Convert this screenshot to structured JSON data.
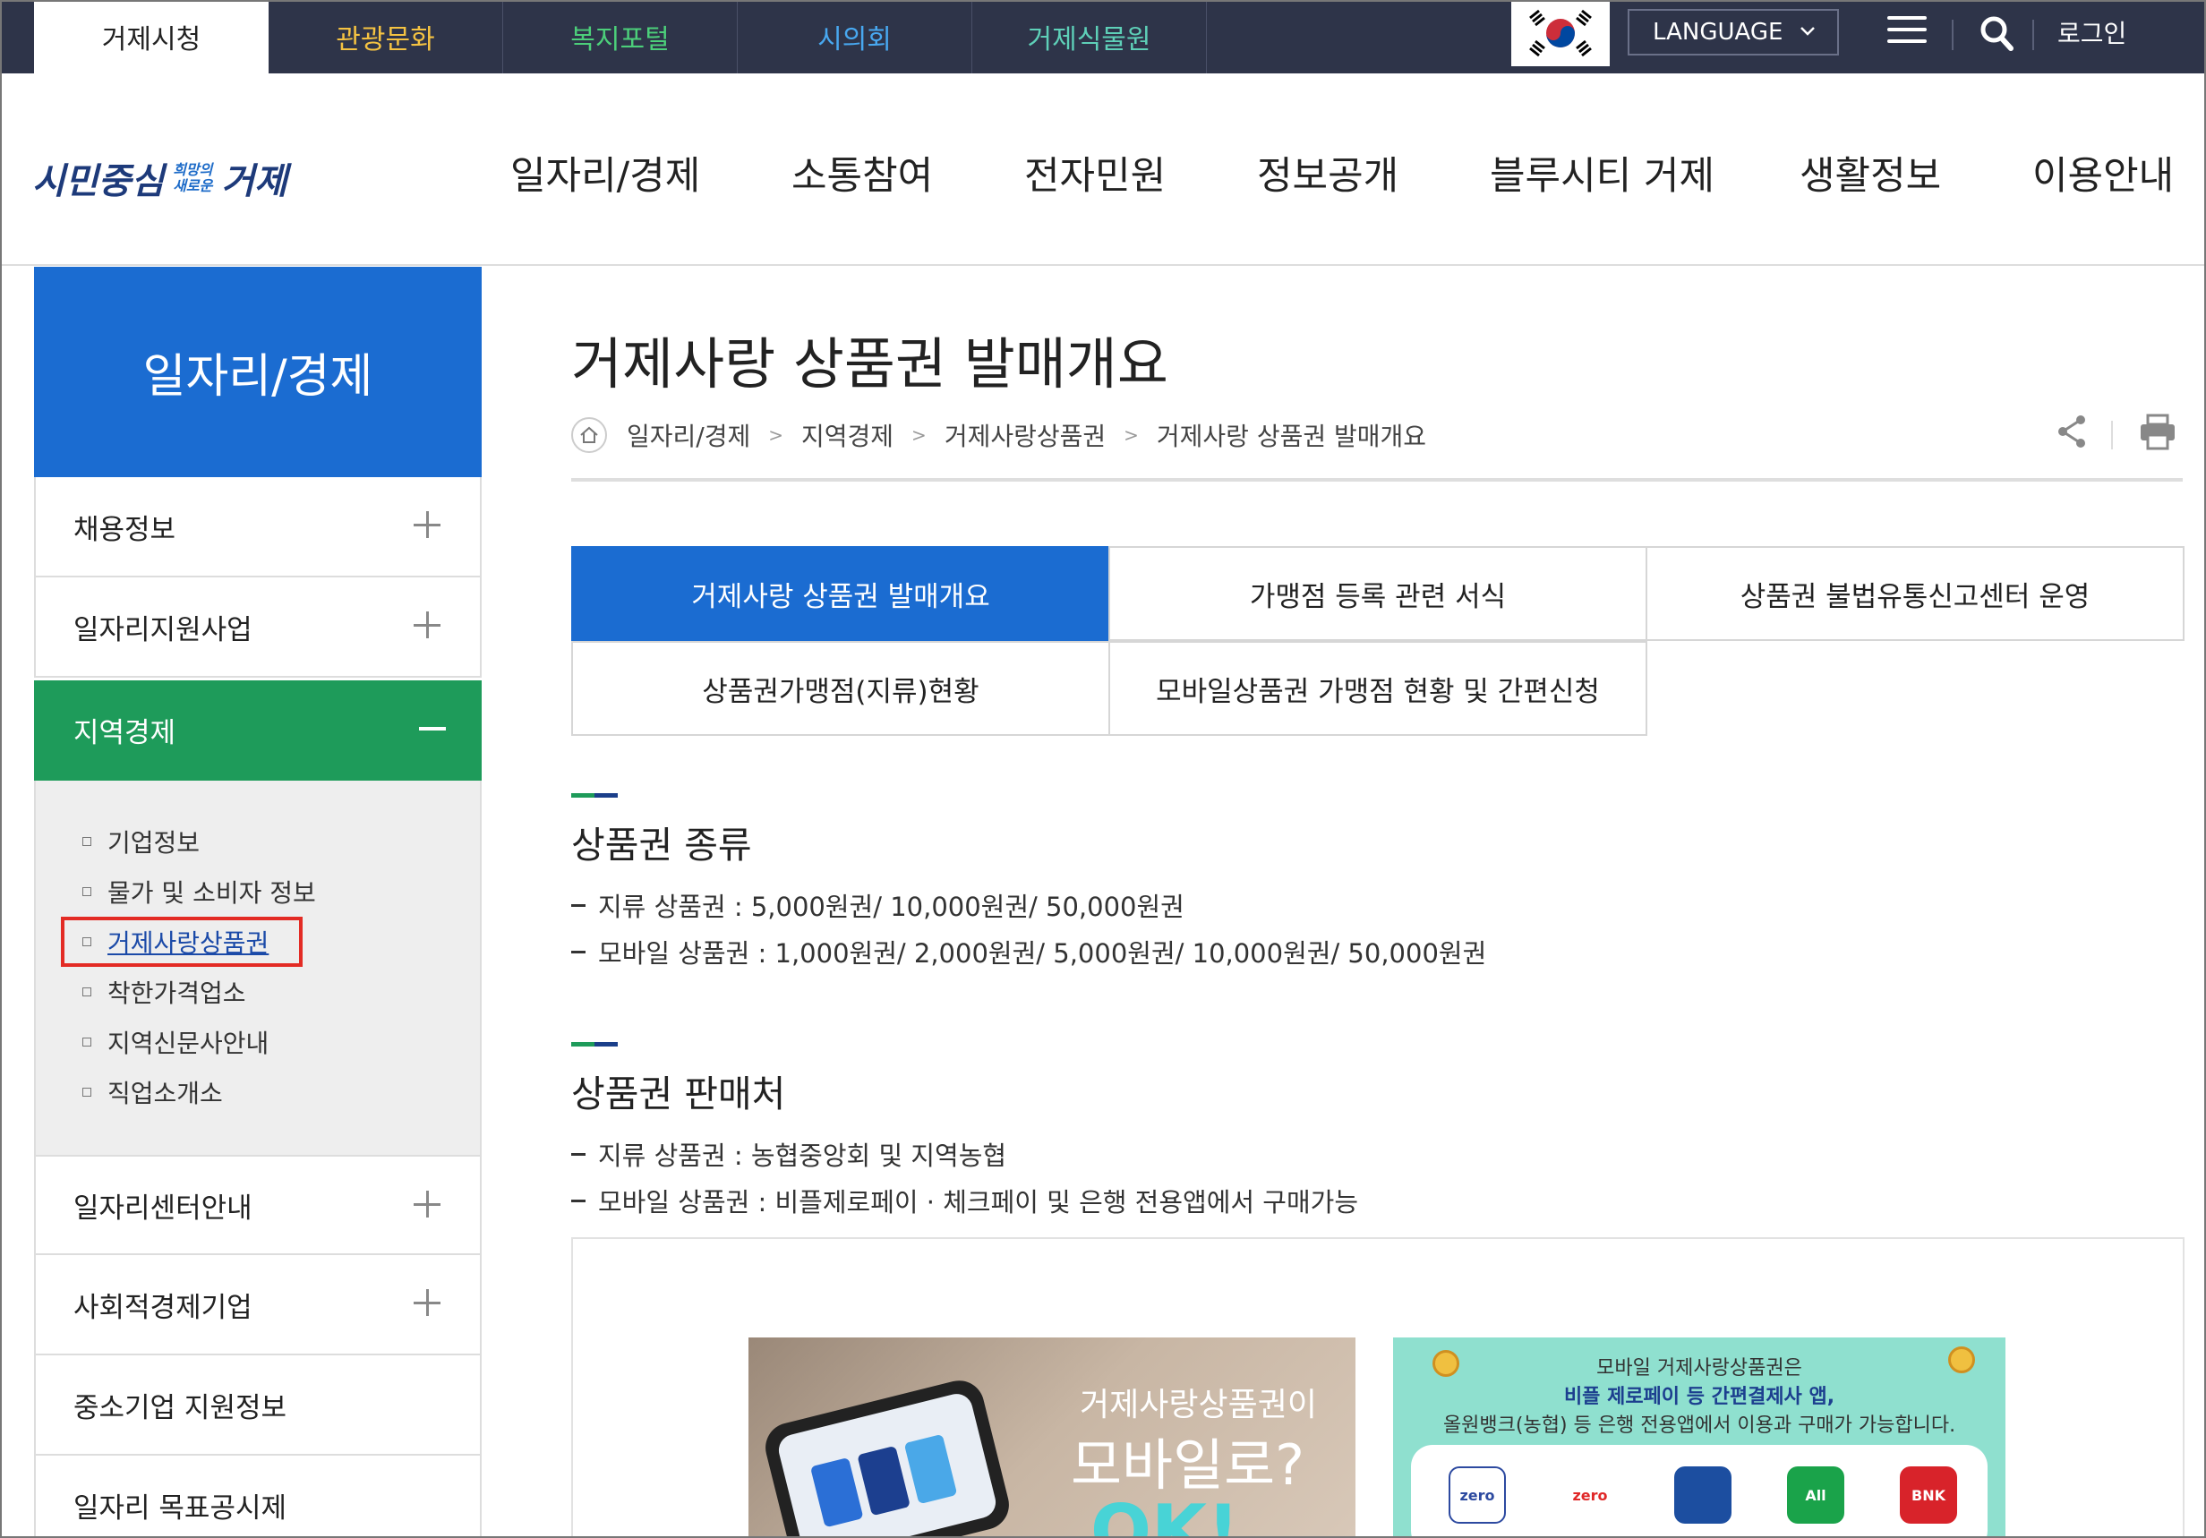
{
  "topbar": {
    "tabs": [
      "거제시청",
      "관광문화",
      "복지포털",
      "시의회",
      "거제식물원"
    ],
    "tab_colors": [
      "#222222",
      "#f5c342",
      "#4ccf7a",
      "#48a8f0",
      "#5ed0b8"
    ],
    "language_label": "LANGUAGE",
    "login_label": "로그인"
  },
  "header": {
    "logo_main_1": "시민중심",
    "logo_small": "희망의\n새로운",
    "logo_main_2": "거제",
    "gnb": [
      "일자리/경제",
      "소통참여",
      "전자민원",
      "정보공개",
      "블루시티 거제",
      "생활정보",
      "이용안내"
    ]
  },
  "sidebar": {
    "title": "일자리/경제",
    "items_before": [
      "채용정보",
      "일자리지원사업"
    ],
    "active_item": "지역경제",
    "sub_items": [
      "기업정보",
      "물가 및 소비자 정보",
      "거제사랑상품권",
      "착한가격업소",
      "지역신문사안내",
      "직업소개소"
    ],
    "items_after": [
      "일자리센터안내",
      "사회적경제기업",
      "중소기업 지원정보",
      "일자리 목표공시제"
    ]
  },
  "content": {
    "page_title": "거제사랑 상품권 발매개요",
    "breadcrumb": [
      "일자리/경제",
      "지역경제",
      "거제사랑상품권",
      "거제사랑 상품권 발매개요"
    ],
    "tabs": [
      "거제사랑 상품권 발매개요",
      "가맹점 등록 관련 서식",
      "상품권 불법유통신고센터 운영",
      "상품권가맹점(지류)현황",
      "모바일상품권 가맹점 현황 및 간편신청"
    ],
    "section1": {
      "title": "상품권 종류",
      "lines": [
        "지류 상품권 : 5,000원권/ 10,000원권/ 50,000원권",
        "모바일 상품권 : 1,000원권/ 2,000원권/ 5,000원권/ 10,000원권/ 50,000원권"
      ]
    },
    "section2": {
      "title": "상품권 판매처",
      "lines": [
        "지류 상품권 : 농협중앙회 및 지역농협",
        "모바일 상품권 : 비플제로페이 · 체크페이 및 은행 전용앱에서 구매가능"
      ]
    },
    "promo1": {
      "line1": "거제사랑상품권이",
      "line2": "모바일로?",
      "line3": "OK!"
    },
    "promo2": {
      "line1": "모바일 거제사랑상품권은",
      "line2": "비플 제로페이 등 간편결제사 앱,",
      "line3": "올원뱅크(농협) 등 은행 전용앱에서 이용과 구매가 가능합니다.",
      "apps": [
        "zero",
        "zero",
        "",
        "All",
        "BNK"
      ]
    }
  }
}
